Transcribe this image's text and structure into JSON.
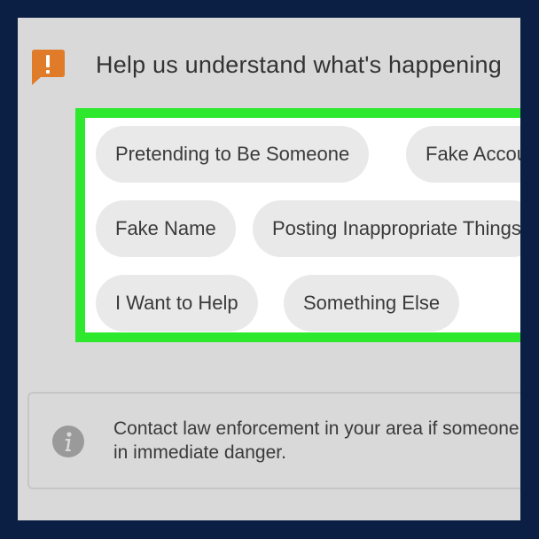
{
  "header": {
    "icon": "exclamation-icon",
    "title": "Help us understand what's happening"
  },
  "options": [
    {
      "label": "Pretending to Be Someone"
    },
    {
      "label": "Fake Account"
    },
    {
      "label": "Fake Name"
    },
    {
      "label": "Posting Inappropriate Things"
    },
    {
      "label": "I Want to Help"
    },
    {
      "label": "Something Else"
    }
  ],
  "info": {
    "icon": "info-icon",
    "line1": "Contact law enforcement in your area if someone is",
    "line2": "in immediate danger."
  },
  "colors": {
    "highlight": "#2ee82e",
    "alert_icon": "#e07b2a",
    "background": "#d9d9d9",
    "frame": "#0b1f45"
  }
}
